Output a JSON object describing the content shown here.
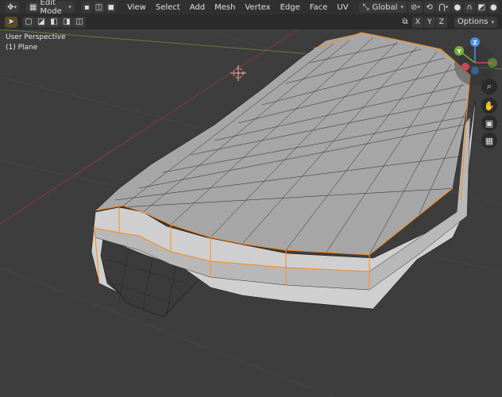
{
  "header": {
    "mode": "Edit Mode",
    "menus": [
      "View",
      "Select",
      "Add",
      "Mesh",
      "Vertex",
      "Edge",
      "Face",
      "UV"
    ],
    "transform_orientation": "Global"
  },
  "subbar": {
    "axes": [
      "X",
      "Y",
      "Z"
    ],
    "options": "Options"
  },
  "viewport": {
    "perspective": "User Perspective",
    "object": "(1) Plane"
  },
  "gizmo": {
    "x": "X",
    "y": "Y",
    "z": "Z"
  },
  "colors": {
    "background": "#3d3d3d",
    "header": "#303030",
    "accent": "#4772b3",
    "mesh_face": "#a9a9a9",
    "selected_edge": "#ff8c1a"
  },
  "icons": [
    "cursor-icon",
    "select-mode-icons",
    "magnet-icon",
    "proportional-icon",
    "zoom-icon",
    "hand-icon",
    "camera-icon",
    "grid-icon"
  ]
}
